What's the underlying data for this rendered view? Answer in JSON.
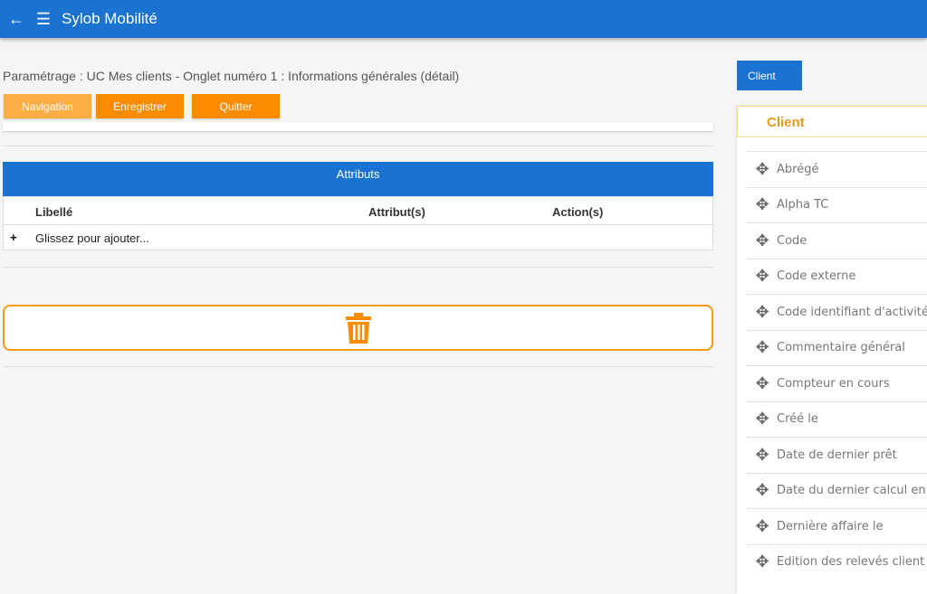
{
  "app": {
    "title": "Sylob Mobilité",
    "back_icon": "arrow-left-icon",
    "menu_icon": "hamburger-menu-icon"
  },
  "page": {
    "title": "Paramétrage : UC Mes clients - Onglet numéro 1 : Informations générales (détail)"
  },
  "toolbar": {
    "navigation": "Navigation",
    "save": "Enregistrer",
    "quit": "Quitter"
  },
  "attributes": {
    "header": "Attributs",
    "columns": [
      "Libellé",
      "Attribut(s)",
      "Action(s)"
    ],
    "add_symbol": "+",
    "add_row": "Glissez pour ajouter..."
  },
  "trash": {
    "icon": "trash-icon"
  },
  "sidepanel": {
    "tab": "Client",
    "title": "Client",
    "items": [
      "Abrégé",
      "Alpha TC",
      "Code",
      "Code externe",
      "Code identifiant d'activité (",
      "Commentaire général",
      "Compteur en cours",
      "Créé le",
      "Date de dernier prêt",
      "Date du dernier calcul en co",
      "Dernière affaire le",
      "Edition des relevés client"
    ]
  },
  "colors": {
    "primary": "#1a73d0",
    "accent": "#fb8c00"
  }
}
